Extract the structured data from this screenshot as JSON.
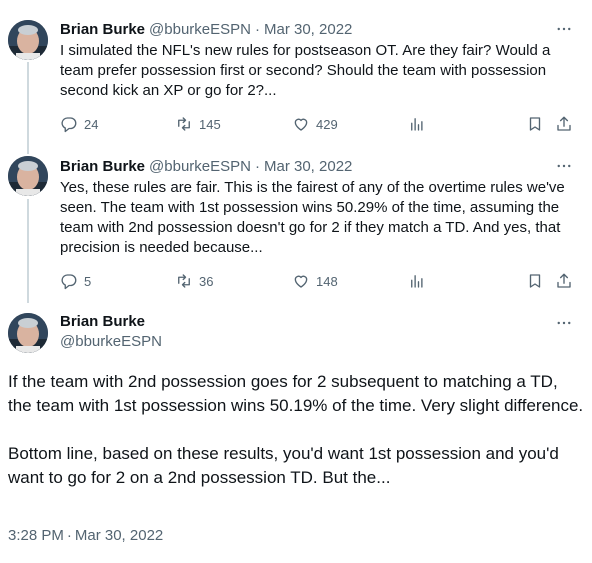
{
  "tweets": [
    {
      "name": "Brian Burke",
      "handle": "@bburkeESPN",
      "separator": "·",
      "date": "Mar 30, 2022",
      "text": "I simulated the NFL's new rules for postseason OT. Are they fair? Would a team prefer possession first or second? Should the team with possession second kick an XP or go for 2?...",
      "replies": "24",
      "retweets": "145",
      "likes": "429"
    },
    {
      "name": "Brian Burke",
      "handle": "@bburkeESPN",
      "separator": "·",
      "date": "Mar 30, 2022",
      "text": "Yes, these rules are fair. This is the fairest of any of the overtime rules we've seen. The team with 1st possession wins 50.29% of the time, assuming the team with 2nd possession doesn't go for 2 if they match a TD. And yes, that precision is needed because...",
      "replies": "5",
      "retweets": "36",
      "likes": "148"
    }
  ],
  "main_tweet": {
    "name": "Brian Burke",
    "handle": "@bburkeESPN",
    "text": "If the team with 2nd possession goes for 2 subsequent to matching a TD, the team with 1st possession wins 50.19% of the time. Very slight difference.\n\nBottom line, based on these results, you'd want 1st possession and you'd want to go for 2 on a 2nd possession TD. But the...",
    "time": "3:28 PM",
    "separator": "·",
    "date": "Mar 30, 2022"
  },
  "icons": {
    "more": "more-horizontal-icon",
    "reply": "reply-icon",
    "retweet": "retweet-icon",
    "like": "heart-icon",
    "views": "analytics-icon",
    "bookmark": "bookmark-icon",
    "share": "share-icon"
  },
  "colors": {
    "text": "#0f1419",
    "secondary": "#536471",
    "thread_line": "#cfd9de"
  }
}
